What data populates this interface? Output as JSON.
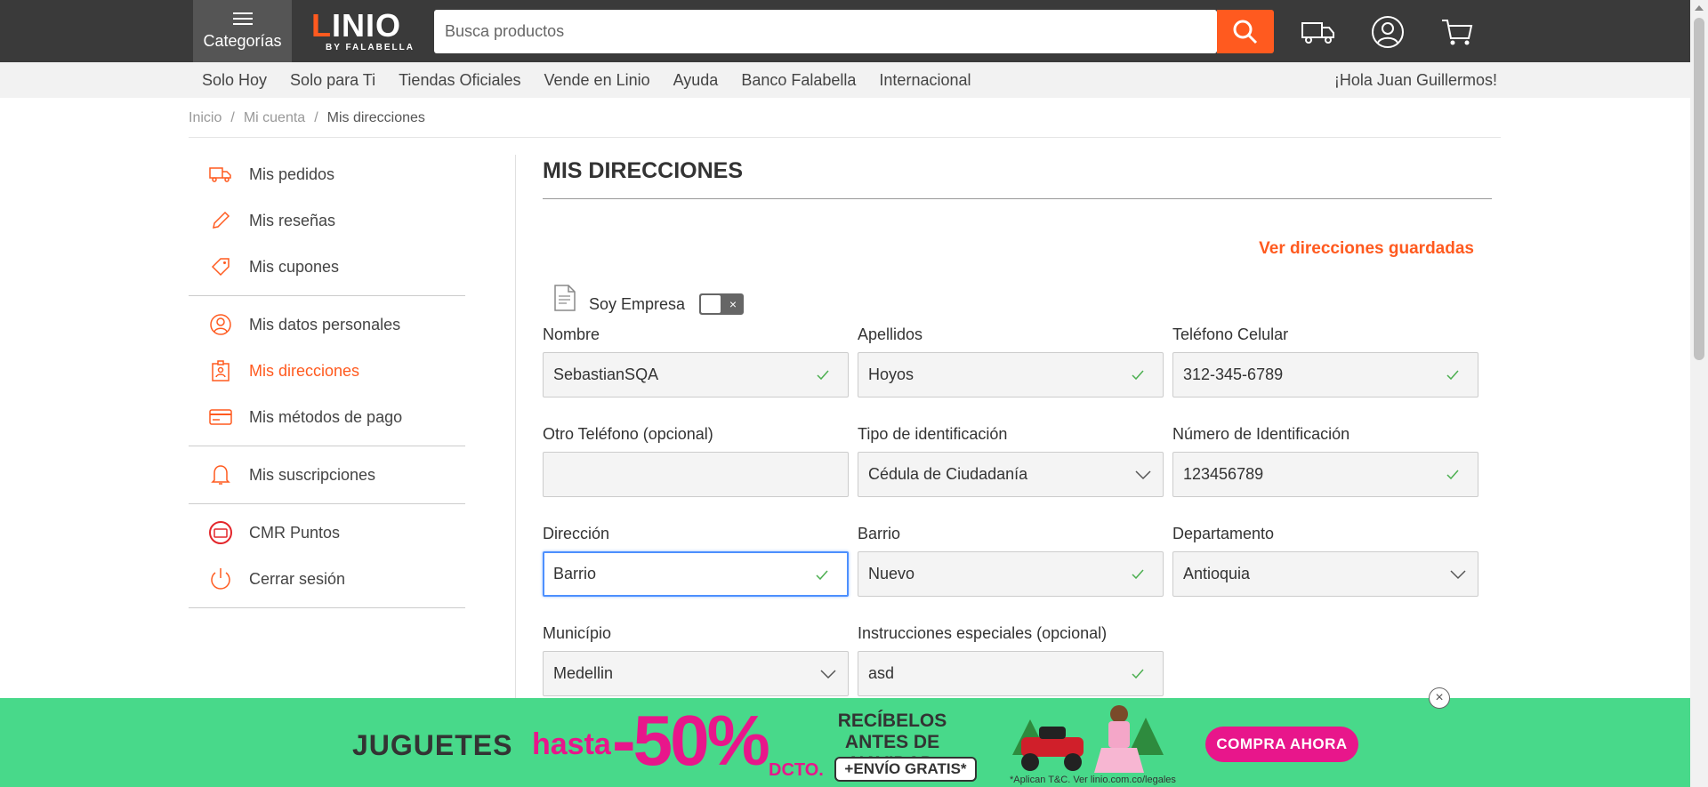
{
  "header": {
    "categories_label": "Categorías",
    "logo_text": "LINIO",
    "logo_sub": "BY FALABELLA",
    "search_placeholder": "Busca productos"
  },
  "subnav": {
    "links": [
      "Solo Hoy",
      "Solo para Ti",
      "Tiendas Oficiales",
      "Vende en Linio",
      "Ayuda",
      "Banco Falabella",
      "Internacional"
    ],
    "greeting": "¡Hola Juan Guillermos!"
  },
  "breadcrumb": [
    "Inicio",
    "Mi cuenta",
    "Mis direcciones"
  ],
  "sidebar": {
    "items": [
      {
        "label": "Mis pedidos",
        "icon": "truck-icon"
      },
      {
        "label": "Mis reseñas",
        "icon": "pencil-icon"
      },
      {
        "label": "Mis cupones",
        "icon": "tag-icon"
      },
      {
        "label": "Mis datos personales",
        "icon": "user-icon"
      },
      {
        "label": "Mis direcciones",
        "icon": "address-icon"
      },
      {
        "label": "Mis métodos de pago",
        "icon": "card-icon"
      },
      {
        "label": "Mis suscripciones",
        "icon": "bell-icon"
      },
      {
        "label": "CMR Puntos",
        "icon": "cmr-icon"
      },
      {
        "label": "Cerrar sesión",
        "icon": "power-icon"
      }
    ]
  },
  "main": {
    "title": "MIS DIRECCIONES",
    "saved_link": "Ver direcciones guardadas",
    "empresa_label": "Soy Empresa",
    "toggle_off_mark": "×",
    "fields": {
      "nombre": {
        "label": "Nombre",
        "value": "SebastianSQA"
      },
      "apellidos": {
        "label": "Apellidos",
        "value": "Hoyos"
      },
      "telefono": {
        "label": "Teléfono Celular",
        "value": "312-345-6789"
      },
      "otro_telefono": {
        "label": "Otro Teléfono (opcional)",
        "value": ""
      },
      "tipo_id": {
        "label": "Tipo de identificación",
        "value": "Cédula de Ciudadanía"
      },
      "numero_id": {
        "label": "Número de Identificación",
        "value": "123456789"
      },
      "direccion": {
        "label": "Dirección",
        "value": "Barrio"
      },
      "barrio": {
        "label": "Barrio",
        "value": "Nuevo"
      },
      "departamento": {
        "label": "Departamento",
        "value": "Antioquia"
      },
      "municipio": {
        "label": "Município",
        "value": "Medellin"
      },
      "instrucciones": {
        "label": "Instrucciones especiales (opcional)",
        "value": "asd"
      }
    }
  },
  "banner": {
    "juguetes": "JUGUETES",
    "hasta": "hasta",
    "discount": "-50%",
    "dcto": "DCTO.",
    "recibelos": "RECÍBELOS ANTES DE NAVIDAD",
    "envio": "+ENVÍO GRATIS*",
    "cta": "COMPRA AHORA",
    "legal": "*Aplican T&C. Ver linio.com.co/legales",
    "close_symbol": "×"
  },
  "colors": {
    "brand_orange": "#ff5a1f",
    "banner_green": "#48d98a",
    "banner_pink": "#e8168b",
    "topbar": "#3a3a3a"
  }
}
